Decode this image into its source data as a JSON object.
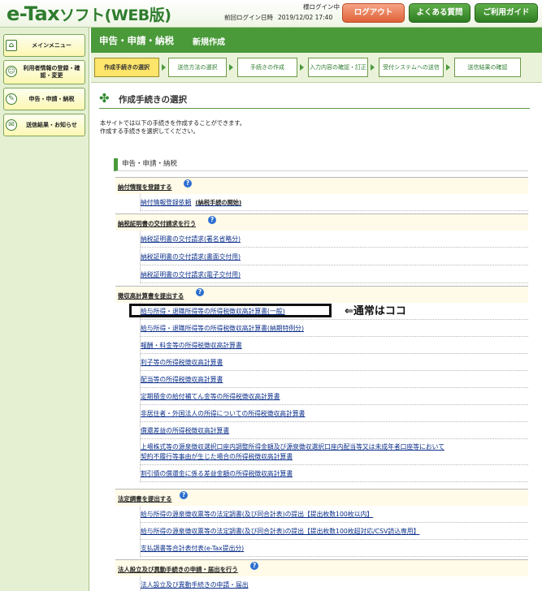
{
  "header": {
    "logo_main": "e-Tax",
    "logo_sub": "ソフト(WEB版)",
    "user_name": "様ログイン中",
    "last_login_label": "前回ログイン日時",
    "last_login_value": "2019/12/02 17:40",
    "logout_label": "ログアウト",
    "faq_label": "よくある質問",
    "guide_label": "ご利用ガイド"
  },
  "sidebar": {
    "items": [
      {
        "label": "メインメニュー",
        "icon": "home-icon"
      },
      {
        "label": "利用者情報の登録・確認・変更",
        "icon": "user-icon"
      },
      {
        "label": "申告・申請・納税",
        "icon": "document-icon"
      },
      {
        "label": "送信結果・お知らせ",
        "icon": "mail-icon"
      }
    ]
  },
  "titlebar": {
    "title": "申告・申請・納税",
    "subtitle": "新規作成"
  },
  "steps": [
    {
      "label": "作成手続きの選択",
      "active": true
    },
    {
      "label": "送信方法の選択",
      "active": false
    },
    {
      "label": "手続きの作成",
      "active": false
    },
    {
      "label": "入力内容の確認・訂正",
      "active": false
    },
    {
      "label": "受付システムへの送信",
      "active": false
    },
    {
      "label": "送信結果の確認",
      "active": false
    }
  ],
  "content": {
    "section_title": "作成手続きの選択",
    "desc_line1": "本サイトでは以下の手続きを作成することができます。",
    "desc_line2": "作成する手続きを選択してください。",
    "category": "申告・申請・納税",
    "groups": [
      {
        "title": "納付情報を登録する",
        "links": [
          {
            "label": "納付情報登録依頼",
            "note": "(納税手続の開始)"
          }
        ]
      },
      {
        "title": "納税証明書の交付請求を行う",
        "links": [
          {
            "label": "納税証明書の交付請求(署名省略分)"
          },
          {
            "label": "納税証明書の交付請求(書面交付用)"
          },
          {
            "label": "納税証明書の交付請求(電子交付用)"
          }
        ]
      },
      {
        "title": "徴収高計算書を提出する",
        "links": [
          {
            "label": "給与所得・退職所得等の所得税徴収高計算書(一般)"
          },
          {
            "label": "給与所得・退職所得等の所得税徴収高計算書(納期特例分)"
          },
          {
            "label": "報酬・料金等の所得税徴収高計算書"
          },
          {
            "label": "利子等の所得税徴収高計算書"
          },
          {
            "label": "配当等の所得税徴収高計算書"
          },
          {
            "label": "定期積金の給付補てん金等の所得税徴収高計算書"
          },
          {
            "label": "非居住者・外国法人の所得についての所得税徴収高計算書"
          },
          {
            "label": "償還差益の所得税徴収高計算書"
          },
          {
            "label": "上場株式等の源泉徴収選択口座内調整所得金額及び源泉徴収選択口座内配当等又は未成年者口座等において",
            "label2": "契約不履行等事由が生じた場合の所得税徴収高計算書"
          },
          {
            "label": "割引債の償還金に係る差益金額の所得税徴収高計算書"
          }
        ]
      },
      {
        "title": "法定調書を提出する",
        "links": [
          {
            "label": "給与所得の源泉徴収票等の法定調書(及び同合計表)の提出【提出枚数100枚以内】"
          },
          {
            "label": "給与所得の源泉徴収票等の法定調書(及び同合計表)の提出【提出枚数100枚超対応/CSV読込専用】"
          },
          {
            "label": "支払調書等合計表付表(e-Tax提出分)"
          }
        ]
      },
      {
        "title": "法人設立及び異動手続きの申請・届出を行う",
        "links": [
          {
            "label": "法人設立及び異動手続きの申請・届出"
          }
        ]
      }
    ],
    "callout": "⇐通常はココ"
  }
}
